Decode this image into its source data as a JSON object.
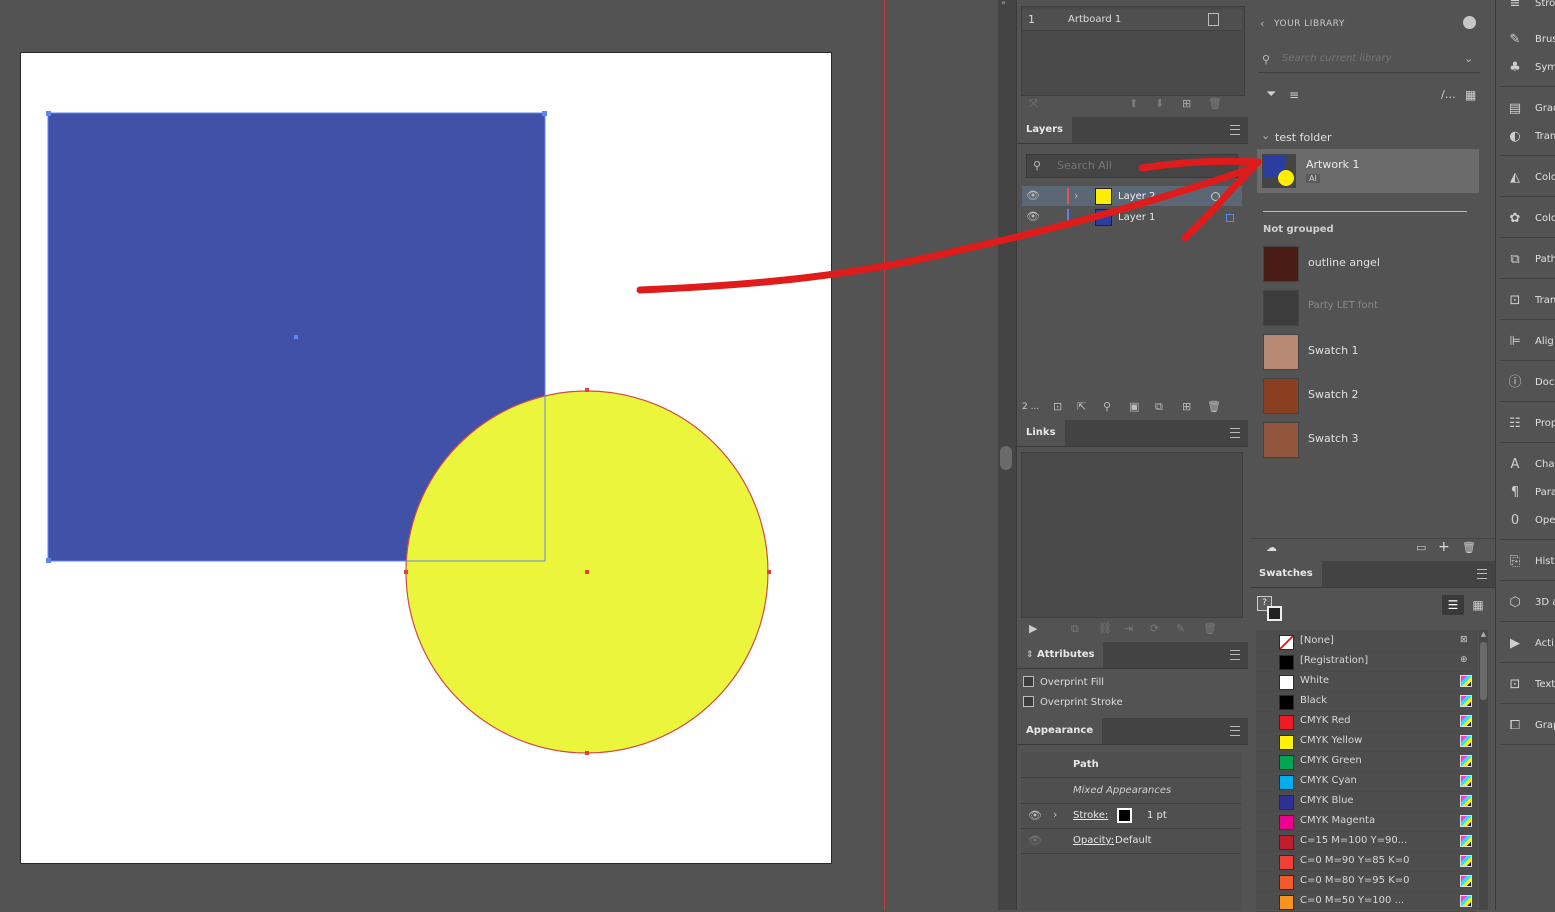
{
  "artboards": {
    "row_number": "1",
    "row_name": "Artboard 1"
  },
  "layers": {
    "tab": "Layers",
    "search_placeholder": "Search All",
    "rows": [
      {
        "name": "Layer 2",
        "color": "#ffee00"
      },
      {
        "name": "Layer 1",
        "color": "#2b3ea0"
      }
    ],
    "footer_count": "2 ..."
  },
  "links": {
    "tab": "Links"
  },
  "attributes": {
    "tab": "Attributes",
    "overprint_fill": "Overprint Fill",
    "overprint_stroke": "Overprint Stroke"
  },
  "appearance": {
    "tab": "Appearance",
    "path_label": "Path",
    "mixed": "Mixed Appearances",
    "stroke_label": "Stroke:",
    "stroke_value": "1 pt",
    "opacity_label": "Opacity:",
    "opacity_value": "Default"
  },
  "library": {
    "back_label": "YOUR LIBRARY",
    "search_placeholder": "Search current library",
    "folder_name": "test folder",
    "artwork_name": "Artwork 1",
    "artwork_badge": "AI",
    "not_grouped": "Not grouped",
    "items": [
      {
        "name": "outline angel",
        "color": "#4a1c16"
      },
      {
        "name": "Party LET font",
        "color": "#3d3d3d"
      },
      {
        "name": "Swatch 1",
        "color": "#b88a76"
      },
      {
        "name": "Swatch 2",
        "color": "#8a3e22"
      },
      {
        "name": "Swatch 3",
        "color": "#92553d"
      }
    ]
  },
  "swatches": {
    "tab": "Swatches",
    "rows": [
      {
        "name": "[None]",
        "color": "#ffffff"
      },
      {
        "name": "[Registration]",
        "color": "#000000"
      },
      {
        "name": "White",
        "color": "#ffffff"
      },
      {
        "name": "Black",
        "color": "#000000"
      },
      {
        "name": "CMYK Red",
        "color": "#ed1c24"
      },
      {
        "name": "CMYK Yellow",
        "color": "#fff200"
      },
      {
        "name": "CMYK Green",
        "color": "#00a651"
      },
      {
        "name": "CMYK Cyan",
        "color": "#00aeef"
      },
      {
        "name": "CMYK Blue",
        "color": "#2e3192"
      },
      {
        "name": "CMYK Magenta",
        "color": "#ec008c"
      },
      {
        "name": "C=15 M=100 Y=90...",
        "color": "#be1e2d"
      },
      {
        "name": "C=0 M=90 Y=85 K=0",
        "color": "#ef4136"
      },
      {
        "name": "C=0 M=80 Y=95 K=0",
        "color": "#f15a29"
      },
      {
        "name": "C=0 M=50 Y=100 ...",
        "color": "#f7941d"
      }
    ]
  },
  "tools": [
    {
      "label": "Stro",
      "icon": "stroke-icon"
    },
    {
      "label": "Brus",
      "icon": "brushes-icon"
    },
    {
      "label": "Sym",
      "icon": "symbols-icon"
    },
    {
      "label": "Grad",
      "icon": "gradient-icon"
    },
    {
      "label": "Tran",
      "icon": "transparency-icon"
    },
    {
      "label": "Colo",
      "icon": "color-icon"
    },
    {
      "label": "Colo",
      "icon": "color-guide-icon"
    },
    {
      "label": "Path",
      "icon": "pathfinder-icon"
    },
    {
      "label": "Tran",
      "icon": "transform-icon"
    },
    {
      "label": "Alig",
      "icon": "align-icon"
    },
    {
      "label": "Docu",
      "icon": "document-info-icon"
    },
    {
      "label": "Prop",
      "icon": "properties-icon"
    },
    {
      "label": "Char",
      "icon": "character-icon"
    },
    {
      "label": "Para",
      "icon": "paragraph-icon"
    },
    {
      "label": "Ope",
      "icon": "opentype-icon"
    },
    {
      "label": "Hist",
      "icon": "history-icon"
    },
    {
      "label": "3D a",
      "icon": "3d-icon"
    },
    {
      "label": "Acti",
      "icon": "actions-icon"
    },
    {
      "label": "Text",
      "icon": "text-import-icon"
    },
    {
      "label": "Grap",
      "icon": "graphic-styles-icon"
    }
  ],
  "colors": {
    "rect_fill": "#4151a7",
    "circle_fill": "#ebf53c",
    "arrow": "#e01b1b"
  }
}
